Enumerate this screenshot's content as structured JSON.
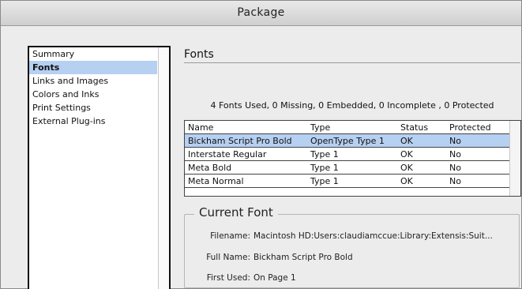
{
  "window": {
    "title": "Package"
  },
  "sidebar": {
    "items": [
      {
        "label": "Summary",
        "selected": false
      },
      {
        "label": "Fonts",
        "selected": true
      },
      {
        "label": "Links and Images",
        "selected": false
      },
      {
        "label": "Colors and Inks",
        "selected": false
      },
      {
        "label": "Print Settings",
        "selected": false
      },
      {
        "label": "External Plug-ins",
        "selected": false
      }
    ]
  },
  "main": {
    "section_title": "Fonts",
    "summary": "4 Fonts Used, 0 Missing, 0 Embedded, 0 Incomplete , 0 Protected",
    "table": {
      "columns": [
        "Name",
        "Type",
        "Status",
        "Protected"
      ],
      "rows": [
        [
          "Bickham Script Pro Bold",
          "OpenType Type 1",
          "OK",
          "No"
        ],
        [
          "Interstate Regular",
          "Type 1",
          "OK",
          "No"
        ],
        [
          "Meta Bold",
          "Type 1",
          "OK",
          "No"
        ],
        [
          "Meta Normal",
          "Type 1",
          "OK",
          "No"
        ]
      ],
      "selected_row": 0
    },
    "current_font": {
      "legend": "Current Font",
      "filename_label": "Filename:",
      "filename_value": "Macintosh HD:Users:claudiamccue:Library:Extensis:Suit...",
      "fullname_label": "Full Name:",
      "fullname_value": "Bickham Script Pro Bold",
      "firstused_label": "First Used:",
      "firstused_value": "On Page 1"
    }
  }
}
